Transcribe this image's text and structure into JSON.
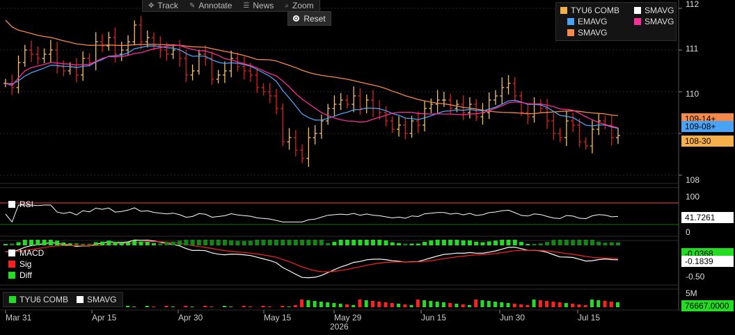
{
  "toolbar": {
    "track": "Track",
    "annotate": "Annotate",
    "news": "News",
    "zoom": "Zoom",
    "reset": "Reset"
  },
  "legend": {
    "items": [
      {
        "label": "TYU6 COMB",
        "color": "#f5b04a"
      },
      {
        "label": "SMAVG",
        "color": "#ffffff"
      },
      {
        "label": "EMAVG",
        "color": "#4aa3f5"
      },
      {
        "label": "SMAVG",
        "color": "#ff2d9a"
      },
      {
        "label": "SMAVG",
        "color": "#f58a4a"
      }
    ]
  },
  "price_axis": {
    "ticks": [
      "112",
      "111",
      "110",
      "108"
    ],
    "tags": [
      {
        "label": "109-14+",
        "bg": "#f58a4a",
        "fg": "#000000"
      },
      {
        "label": "109-08+",
        "bg": "#4aa3f5",
        "fg": "#000000"
      },
      {
        "label": "108-30",
        "bg": "#f5b04a",
        "fg": "#000000"
      }
    ]
  },
  "rsi": {
    "label": "RSI",
    "ticks": [
      "100",
      "0"
    ],
    "value_tag": "41.7261",
    "color": "#ffffff",
    "line_color": "#ff3b3b"
  },
  "macd": {
    "labels": [
      "MACD",
      "Sig",
      "Diff"
    ],
    "colors": [
      "#ffffff",
      "#ff2020",
      "#22dd22"
    ],
    "ticks": [
      "-0.50"
    ],
    "tags": [
      {
        "label": "-0.0368",
        "bg": "#22dd22",
        "fg": "#000000"
      },
      {
        "label": "-0.1839",
        "bg": "#ffffff",
        "fg": "#000000"
      }
    ]
  },
  "volume": {
    "legend": [
      {
        "label": "TYU6 COMB",
        "color": "#22dd22"
      },
      {
        "label": "SMAVG",
        "color": "#ffffff"
      }
    ],
    "ticks": [
      "5M"
    ],
    "tag": {
      "label": "76667.0000",
      "bg": "#22dd22",
      "fg": "#000000"
    }
  },
  "x_axis": {
    "labels": [
      "Mar 31",
      "Apr 15",
      "Apr 30",
      "May 15",
      "May 29",
      "Jun 15",
      "Jun 30",
      "Jul 15"
    ],
    "year": "2026"
  },
  "colors": {
    "up": "#f5c26b",
    "down": "#e02020",
    "ema": "#4aa3f5",
    "sma_pink": "#ff2d9a",
    "sma_orange": "#f58a4a",
    "grid": "#2a2a2a"
  },
  "chart_data": {
    "type": "line",
    "ylim": [
      107.9,
      112.1
    ],
    "ohlc_closes": [
      110.2,
      110.1,
      110.7,
      111.0,
      110.9,
      110.8,
      110.9,
      111.0,
      110.6,
      110.5,
      110.6,
      110.4,
      110.8,
      110.7,
      111.2,
      111.1,
      111.3,
      110.9,
      111.0,
      111.2,
      111.6,
      111.2,
      111.3,
      111.1,
      111.0,
      110.9,
      111.0,
      110.8,
      110.4,
      110.5,
      110.9,
      110.8,
      110.3,
      110.4,
      110.5,
      110.8,
      110.6,
      110.5,
      110.4,
      110.1,
      110.0,
      109.9,
      109.6,
      108.8,
      108.9,
      108.6,
      108.4,
      108.9,
      109.0,
      109.3,
      109.6,
      109.7,
      109.8,
      109.7,
      109.9,
      109.6,
      109.8,
      109.6,
      109.5,
      109.3,
      109.1,
      109.2,
      109.0,
      109.3,
      109.2,
      109.6,
      109.7,
      109.8,
      109.8,
      109.6,
      109.7,
      109.5,
      109.7,
      109.4,
      109.5,
      109.8,
      109.9,
      110.1,
      110.2,
      109.9,
      109.5,
      109.4,
      109.7,
      109.6,
      109.3,
      109.0,
      108.9,
      109.3,
      109.2,
      108.8,
      108.7,
      109.1,
      109.3,
      109.2,
      108.9,
      108.95
    ],
    "macd": {
      "last": -0.1839,
      "diff_last": -0.0368
    },
    "rsi_last": 41.7261
  }
}
